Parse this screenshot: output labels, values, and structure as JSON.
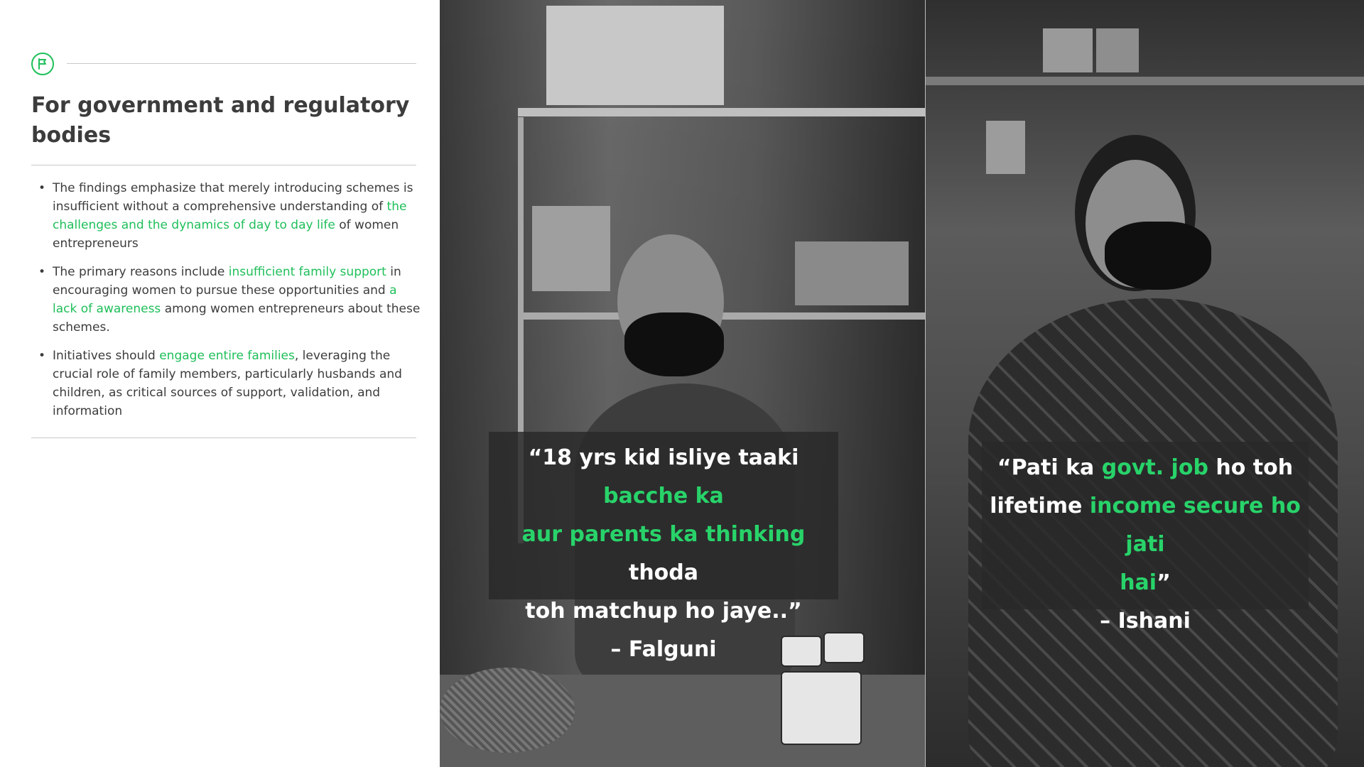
{
  "section": {
    "icon": "flag-icon",
    "title": "For government and regulatory bodies"
  },
  "bullets": [
    {
      "parts": [
        {
          "text": "The findings emphasize that merely introducing schemes is insufficient without a comprehensive understanding of ",
          "highlight": false
        },
        {
          "text": "the challenges and the dynamics of day to day life",
          "highlight": true
        },
        {
          "text": " of women entrepreneurs",
          "highlight": false
        }
      ]
    },
    {
      "parts": [
        {
          "text": "The primary reasons include ",
          "highlight": false
        },
        {
          "text": "insufficient family support",
          "highlight": true
        },
        {
          "text": " in encouraging women to pursue these opportunities and ",
          "highlight": false
        },
        {
          "text": "a lack of awareness",
          "highlight": true
        },
        {
          "text": " among women entrepreneurs about these schemes.",
          "highlight": false
        }
      ]
    },
    {
      "parts": [
        {
          "text": "Initiatives should ",
          "highlight": false
        },
        {
          "text": "engage entire families",
          "highlight": true
        },
        {
          "text": ", leveraging the crucial role of family members, particularly husbands and children, as critical sources of support, validation, and information",
          "highlight": false
        }
      ]
    }
  ],
  "quotes": [
    {
      "lines": [
        [
          {
            "text": "“18 yrs kid isliye taaki ",
            "highlight": false
          },
          {
            "text": "bacche ka",
            "highlight": true
          }
        ],
        [
          {
            "text": "aur parents ka thinking",
            "highlight": true
          },
          {
            "text": " thoda",
            "highlight": false
          }
        ],
        [
          {
            "text": "toh matchup ho jaye..”",
            "highlight": false
          }
        ]
      ],
      "author": "– Falguni"
    },
    {
      "lines": [
        [
          {
            "text": "“Pati ka ",
            "highlight": false
          },
          {
            "text": "govt. job",
            "highlight": true
          },
          {
            "text": " ho toh",
            "highlight": false
          }
        ],
        [
          {
            "text": "lifetime ",
            "highlight": false
          },
          {
            "text": "income secure ho jati",
            "highlight": true
          }
        ],
        [
          {
            "text": "hai",
            "highlight": true
          },
          {
            "text": "”",
            "highlight": false
          }
        ]
      ],
      "author": "– Ishani"
    }
  ],
  "colors": {
    "accent": "#1fbf5a",
    "quote_accent": "#28d36a",
    "text": "#3c3c3c"
  }
}
